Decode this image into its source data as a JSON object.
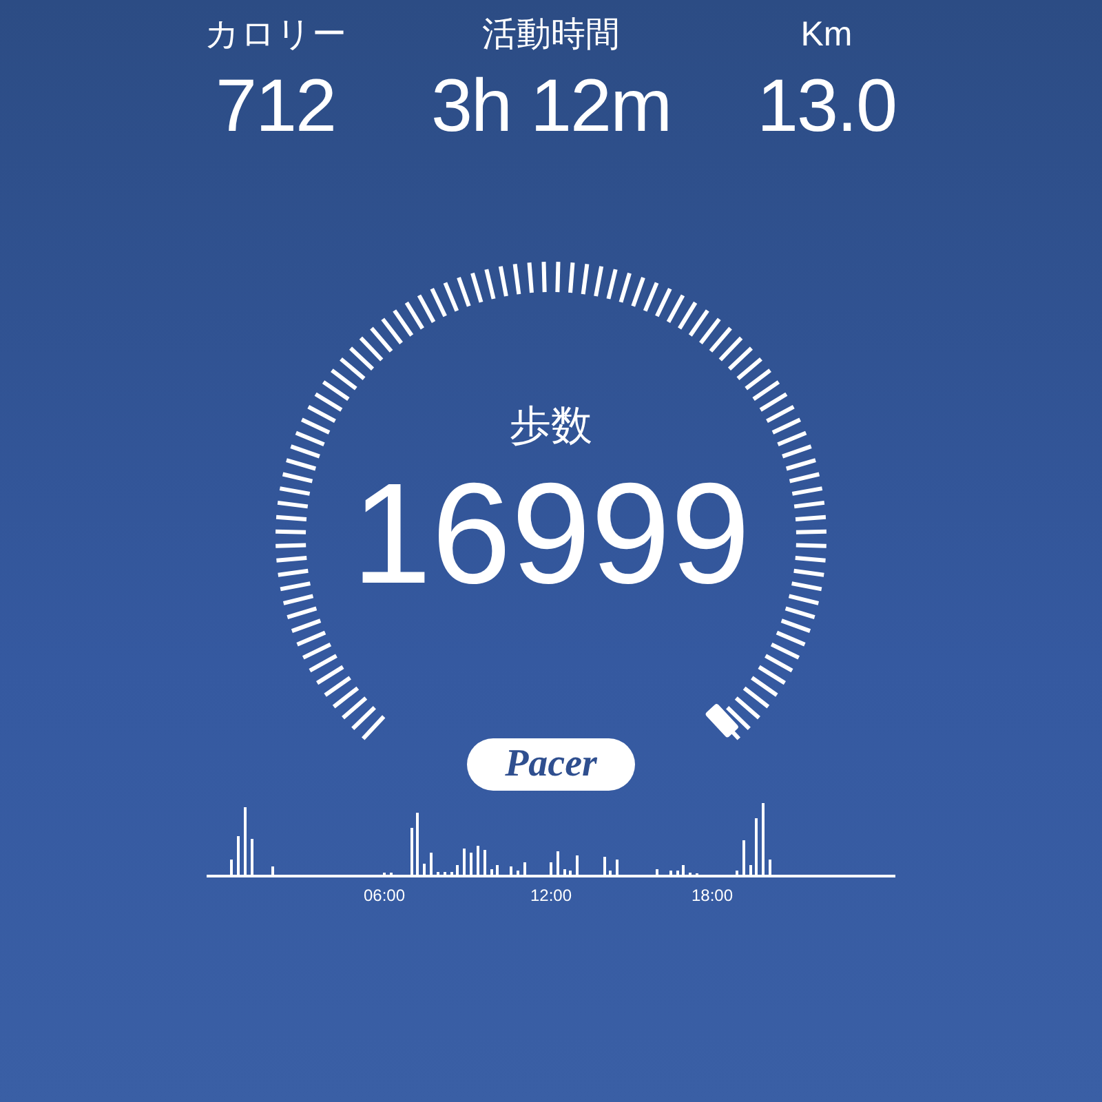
{
  "stats": [
    {
      "label": "カロリー",
      "value": "712"
    },
    {
      "label": "活動時間",
      "value": "3h 12m"
    },
    {
      "label": "Km",
      "value": "13.0"
    }
  ],
  "steps": {
    "label": "歩数",
    "value": "16999"
  },
  "logo": "Pacer",
  "activity_chart": {
    "time_labels": [
      "06:00",
      "12:00",
      "18:00"
    ]
  }
}
